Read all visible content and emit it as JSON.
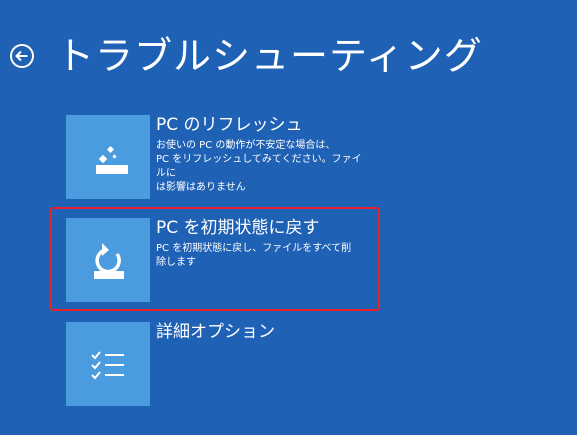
{
  "header": {
    "title": "トラブルシューティング"
  },
  "options": [
    {
      "title": "PC のリフレッシュ",
      "description": "お使いの PC の動作が不安定な場合は、\nPC をリフレッシュしてみてください。ファイルに\nは影響はありません"
    },
    {
      "title": "PC を初期状態に戻す",
      "description": "PC を初期状態に戻し、ファイルをすべて削\n除します"
    },
    {
      "title": "詳細オプション",
      "description": ""
    }
  ],
  "colors": {
    "background": "#1f61b5",
    "tile": "#4a9cde",
    "highlight_border": "#e8212a"
  }
}
